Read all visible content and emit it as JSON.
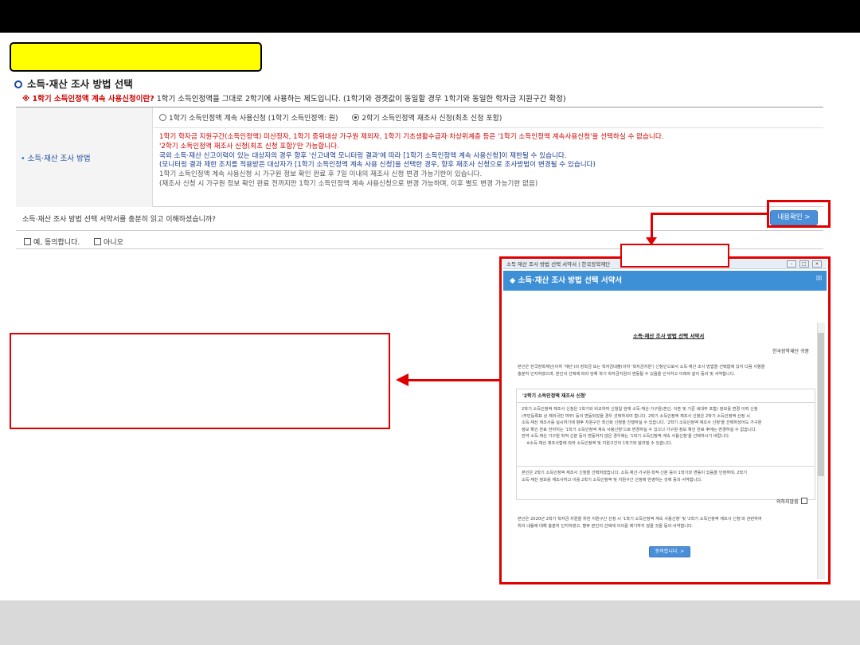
{
  "section": {
    "title": "소득·재산 조사 방법 선택"
  },
  "notice": {
    "red": "※ 1학기 소득인정액 계속 사용신청이란?",
    "text": " 1학기 소득인정액을 그대로 2학기에 사용하는 제도입니다. (1학기와 경곗값이 동일할 경우 1학기와 동일한 학자금 지원구간 확정)"
  },
  "method": {
    "label": "소득·재산 조사 방법",
    "option1": "1학기 소득인정액 계속 사용신청 (1학기 소득인정액: 원)",
    "option2": "2학기 소득인정액 재조사 신청(최초 신청 포함)",
    "desc": [
      "1학기 학자금 지원구간(소득인정액) 미산정자, 1학기 중위대상 가구원 제외자, 1학기 기초생활수급자·차상위계층 등은 '1학기 소득인정액 계속사용신청'을 선택하실 수 없습니다.",
      "'2학기 소득인정액 재조사 신청(최초 신청 포함)'만 가능합니다.",
      "국외 소득·재산 신고이력이 있는 대상자의 경우 향후 '신고내역 모니터링 결과'에 따라 [1학기 소득인정액 계속 사용신청]이 제한될 수 있습니다.",
      "(모니터링 결과 제한 조치를 적용받은 대상자가 [1학기 소득인정액 계속 사용 신청]을 선택한 경우, 향후 재조사 신청으로 조사방법이 변경될 수 있습니다)",
      "1학기 소득인정액 계속 사용신청 시 가구원 정보 확인 완료 후 7일 이내의 재조사 신청 변경 가능기한이 있습니다.",
      "(재조사 신청 시 가구원 정보 확인 완료 전까지만 1학기 소득인정액 계속 사용신청으로 변경 가능하며, 이후 별도 변경 가능기한 없음)"
    ]
  },
  "confirm": {
    "question": "소득·재산 조사 방법 선택 서약서를 충분히 읽고 이해하셨습니까?",
    "detail_button": "내용확인 >",
    "yes": "예, 동의합니다.",
    "no": "아니오"
  },
  "popup": {
    "window_title": "소득·재산 조사 방법 선택 서약서 | 한국장학재단",
    "header": "◆ 소득·재산 조사 방법 선택 서약서",
    "doc_title": "소득·재산 조사 방법 선택 서약서",
    "org": "한국장학재단 귀중",
    "intro": [
      "본인은 한국장학재단(이하 '재단')의 장학금 또는 학자금대출(이하 '학자금지원') 신청인으로서 소득·재산 조사 방법을 선택함에 있어 다음 사항을",
      "충분히 인지하였으며, 본인의 선택에 따라 당해 학기 학자금지원의 변동될 수 있음을 인식하고 아래와 같이 동의 및 서약합니다."
    ],
    "sub_title": "'2학기 소득인정액 재조사 신청'",
    "box_lines": [
      "2학기 소득인정액 재조사 신청은 1학기와 비교하여 신청일 현재 소득·재산·가구원(혼인, 이혼 및 기준 세대주 포함) 정보를 변경 이력 신청",
      "(주민등록표 상 재외국민 여부) 등이 변동되었을 경우 선택하셔야 합니다. 2학기 소득인정액 재조사 신청은 2학기 소득인정액 산정 시",
      "소득·재산 재조사를 실시하기에 향후 지원구간 최신화 신청을 진행하실 수 있습니다. '2학기 소득인정액 재조사 신청'을 선택하셨어도 가구원",
      "정보 확인 완료 전까지는 '1학기 소득인정액 계속 사용신청'으로 변경하실 수 있으나 가구원 정보 확인 완료 후에는 변경하실 수 없습니다.",
      "만약 소득·재산 가구원 학적·신분 등이 변동하지 않은 경우에는 '1학기 소득인정액 계속 사용신청'을 선택하시기 바랍니다.",
      "※소득·재산 재조사함에 따라 소득인정액 및 지원구간이 1학기와 달라질 수 있습니다."
    ],
    "box_lines2": [
      "본인은 2학기 소득인정액 재조사 신청을 선택하였습니다. 소득·재산·가구원·학적·신분 등이 1학기와 변동이 있음을 인정하며, 2학기",
      "소득·재산 정보를 재조사하고 이를 2학기 소득인정액 및 지원구간 산정에 반영하는 것에 동의·서약합니다."
    ],
    "unchecked_label": "의하지않음",
    "closing": [
      "본인은 2020년 2학기 학자금 지원을 위한 지원구간 산정 시 '1학기 소득인정액 계속 사용신청' 및 '2학기 소득인정액 재조사 신청'과 관련하여",
      "위의 내용에 대해 충분히 인지하였고, 향후 본인의 선택에 이의를 제기하지 않을 것을 동의·서약합니다."
    ],
    "agree_button": "동의합니다. >"
  },
  "colors": {
    "accent": "#3d8fd6",
    "highlight": "#e00000",
    "yellow": "#ffff00"
  }
}
